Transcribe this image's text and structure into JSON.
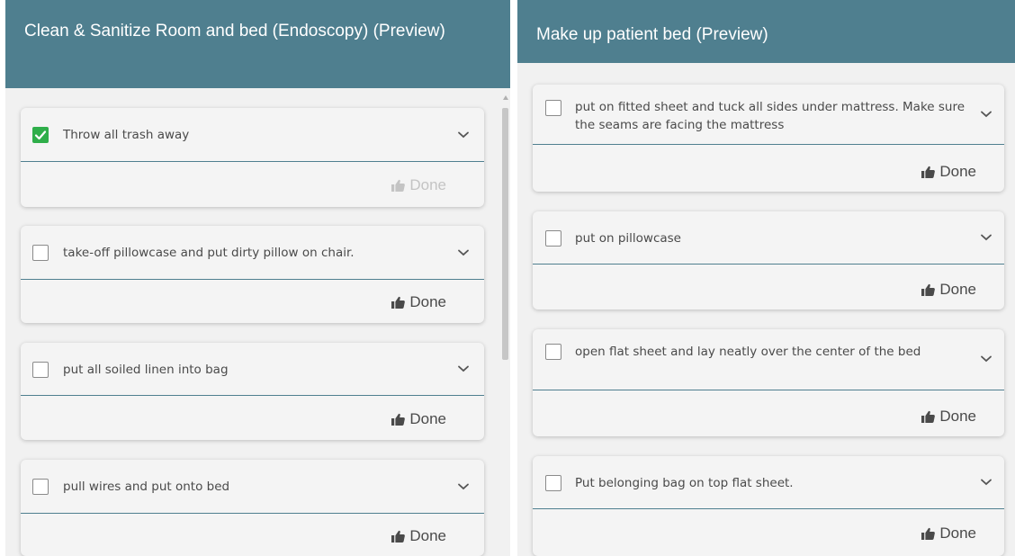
{
  "left_panel": {
    "title": "Clean & Sanitize Room and bed (Endoscopy) (Preview)",
    "tasks": [
      {
        "text": "Throw all trash away",
        "checked": true,
        "done_label": "Done"
      },
      {
        "text": "take-off pillowcase and put dirty pillow on chair.",
        "checked": false,
        "done_label": "Done"
      },
      {
        "text": "put all soiled linen into bag",
        "checked": false,
        "done_label": "Done"
      },
      {
        "text": "pull wires and put onto bed",
        "checked": false,
        "done_label": "Done"
      }
    ]
  },
  "right_panel": {
    "title": "Make up patient bed (Preview)",
    "tasks": [
      {
        "text": "put on fitted sheet and tuck all sides under mattress. Make sure the seams are facing the mattress",
        "checked": false,
        "done_label": "Done"
      },
      {
        "text": "put on pillowcase",
        "checked": false,
        "done_label": "Done"
      },
      {
        "text": "open flat sheet and lay neatly over the center of the bed",
        "checked": false,
        "done_label": "Done"
      },
      {
        "text": "Put belonging bag on top flat sheet.",
        "checked": false,
        "done_label": "Done"
      }
    ]
  },
  "icons": {
    "checkbox": "checkbox-icon",
    "check": "checkmark-icon",
    "expand": "chevron-down-icon",
    "done": "thumbs-up-icon"
  },
  "colors": {
    "header": "#4f7f8f",
    "checked": "#2fae4a",
    "divider": "#4f7f8f"
  }
}
